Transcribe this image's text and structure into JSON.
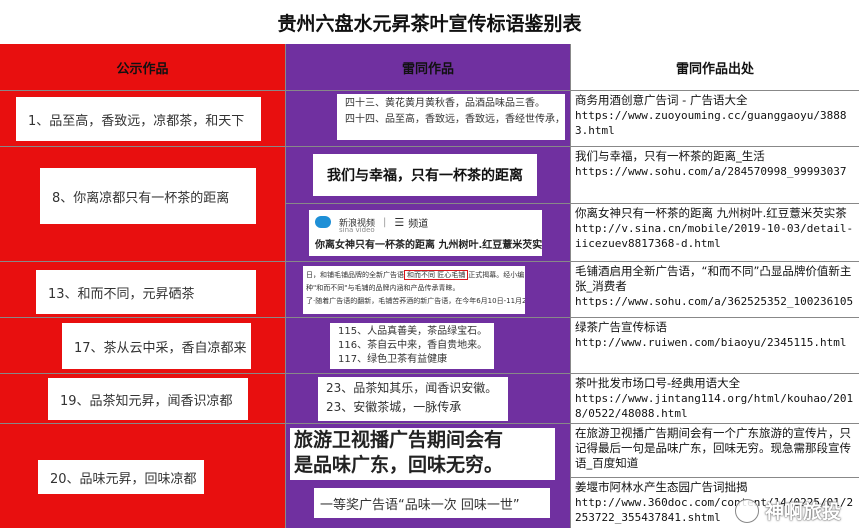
{
  "title": "贵州六盘水元昇茶叶宣传标语鉴别表",
  "headers": [
    "公示作品",
    "雷同作品",
    "雷同作品出处"
  ],
  "colors": {
    "red": "#e80f0f",
    "purple": "#7030a0"
  },
  "rows": [
    {
      "entry": "1、品至高，香致远，凉都茶，和天下",
      "similar_lines": [
        "四十三、黄花黄月黄秋香，品酒品味品三香。",
        "四十四、品至高，香致远，香致远，香经世传承，香酒品质永恒。"
      ],
      "source_title": "商务用酒创意广告词 - 广告语大全",
      "source_url": "https://www.zuoyouming.cc/guanggaoyu/38883.html"
    },
    {
      "entry": "8、你离凉都只有一杯茶的距离",
      "similar_bold": "我们与幸福，只有一杯茶的距离",
      "source_title": "我们与幸福，只有一杯茶的距离_生活",
      "source_url": "https://www.sohu.com/a/284570998_99993037"
    },
    {
      "video_site": "新浪视频",
      "video_site_sub": "sina video",
      "video_channel": "频道",
      "video_caption": "你离女神只有一杯茶的距离 九州树叶.红豆薏米芡实茶",
      "source_title": "你离女神只有一杯茶的距离 九州树叶.红豆薏米芡实茶",
      "source_url": "http://v.sina.cn/mobile/2019-10-03/detail-iicezuev8817368-d.html"
    },
    {
      "entry": "13、和而不同，元昇硒茶",
      "similar_line_pre": "日，和铺毛铺品牌的全新广告语",
      "similar_line_hl": "和而不同 匠心毛铺",
      "similar_line_post": "正式揭幕。经小编",
      "similar_line2": "种\"和而不同\"与毛铺的品牌内涵和产品传承青睐。",
      "similar_line3": "了·随着广告语的翻新，毛铺苦荞酒的新广告语，在今年6月10日-11月2",
      "source_title": "毛铺酒启用全新广告语，“和而不同”凸显品牌价值新主张_消费者",
      "source_url": "https://www.sohu.com/a/362525352_100236105"
    },
    {
      "entry": "17、茶从云中采，香自凉都来",
      "similar_lines": [
        "115、人品真善美，茶品绿宝石。",
        "116、茶自云中来，香自贵地来。",
        "117、绿色卫茶有益健康"
      ],
      "source_title": "绿茶广告宣传标语",
      "source_url": "http://www.ruiwen.com/biaoyu/2345115.html"
    },
    {
      "entry": "19、品茶知元昇，闻香识凉都",
      "similar_lines": [
        "23、品茶知其乐，闻香识安徽。",
        "23、安徽茶城，一脉传承"
      ],
      "source_title": "茶叶批发市场口号-经典用语大全",
      "source_url": "https://www.jintang114.org/html/kouhao/2018/0522/48088.html"
    },
    {
      "entry": "20、品味元昇，回味凉都",
      "similar_big1": "旅游卫视播广告期间会有",
      "similar_big2": "是品味广东，回味无穷。",
      "source_title": "在旅游卫视播广告期间会有一个广东旅游的宣传片，只记得最后一句是品味广东，回味无穷。现急需那段宣传语_百度知道"
    },
    {
      "similar_line": "一等奖广告语“品味一次 回味一世”",
      "source_title": "姜堰市阿林水产生态园广告词拙揭",
      "source_url": "http://www.360doc.com/content/14/0225/01/2253722_355437841.shtml"
    }
  ],
  "watermark": "神啊旅投"
}
